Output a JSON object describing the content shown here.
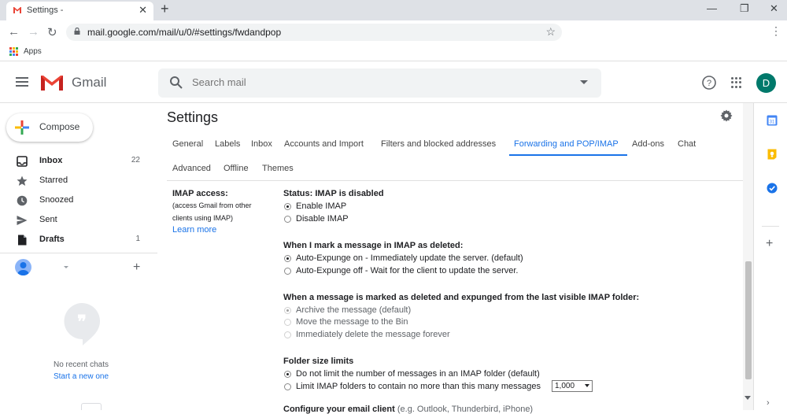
{
  "browser": {
    "tab_title": "Settings -",
    "tab_close": "✕",
    "new_tab": "+",
    "window_controls": [
      "—",
      "❐",
      "✕"
    ],
    "url": "mail.google.com/mail/u/0/#settings/fwdandpop",
    "bookmarks_apps": "Apps"
  },
  "header": {
    "product": "Gmail",
    "search_placeholder": "Search mail",
    "avatar_initial": "D"
  },
  "compose_label": "Compose",
  "sidebar": {
    "items": [
      {
        "label": "Inbox",
        "count": "22",
        "icon": "inbox-icon",
        "bold": true
      },
      {
        "label": "Starred",
        "count": "",
        "icon": "star-icon",
        "bold": false
      },
      {
        "label": "Snoozed",
        "count": "",
        "icon": "clock-icon",
        "bold": false
      },
      {
        "label": "Sent",
        "count": "",
        "icon": "send-icon",
        "bold": false
      },
      {
        "label": "Drafts",
        "count": "1",
        "icon": "draft-icon",
        "bold": true
      }
    ],
    "no_chats": "No recent chats",
    "start_new": "Start a new one"
  },
  "settings": {
    "title": "Settings",
    "tabs": [
      "General",
      "Labels",
      "Inbox",
      "Accounts and Import",
      "Filters and blocked addresses",
      "Forwarding and POP/IMAP",
      "Add-ons",
      "Chat",
      "Advanced",
      "Offline",
      "Themes"
    ],
    "active_tab": "Forwarding and POP/IMAP",
    "imap_label": "IMAP access:",
    "imap_desc_1": "(access Gmail from other",
    "imap_desc_2": "clients using IMAP)",
    "learn_more": "Learn more",
    "status_heading": "Status: IMAP is disabled",
    "status_options": [
      "Enable IMAP",
      "Disable IMAP"
    ],
    "deleted_heading": "When I mark a message in IMAP as deleted:",
    "deleted_options": [
      "Auto-Expunge on - Immediately update the server. (default)",
      "Auto-Expunge off - Wait for the client to update the server."
    ],
    "expunged_heading": "When a message is marked as deleted and expunged from the last visible IMAP folder:",
    "expunged_options": [
      "Archive the message (default)",
      "Move the message to the Bin",
      "Immediately delete the message forever"
    ],
    "folder_heading": "Folder size limits",
    "folder_options": [
      "Do not limit the number of messages in an IMAP folder (default)",
      "Limit IMAP folders to contain no more than this many messages"
    ],
    "folder_limit_value": "1,000",
    "configure_heading": "Configure your email client",
    "configure_hint": " (e.g. Outlook, Thunderbird, iPhone)"
  },
  "colors": {
    "accent": "#1a73e8",
    "gmail_red": "#ea4335",
    "avatar": "#00796b"
  }
}
